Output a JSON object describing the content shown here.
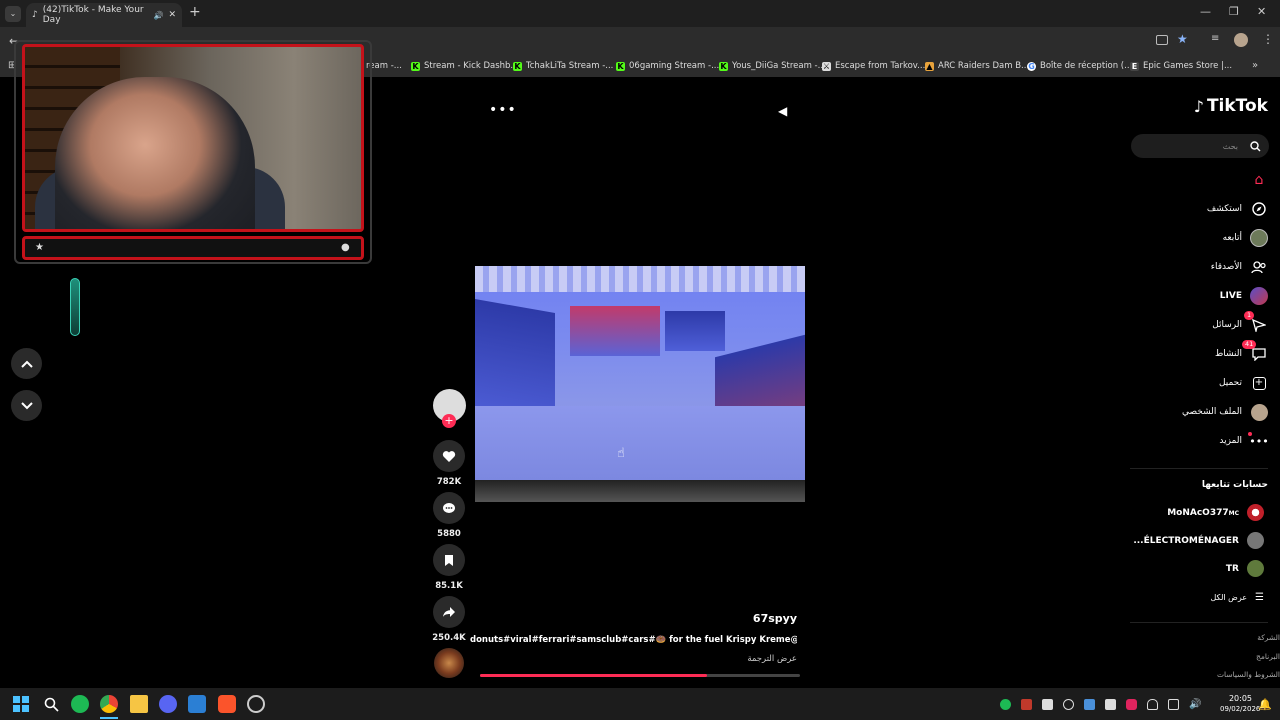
{
  "browser": {
    "tab_title": "(42)TikTok - Make Your Day",
    "bookmarks": [
      "ream -...",
      "Stream - Kick Dashb...",
      "TchakLiTa Stream -...",
      "06gaming Stream -...",
      "Yous_DiiGa Stream -...",
      "Escape from Tarkov...",
      "ARC Raiders Dam B...",
      "Boîte de réception (...",
      "Epic Games Store |..."
    ]
  },
  "tiktok": {
    "logo": "TikTok",
    "search_placeholder": "بحث",
    "nav": [
      {
        "label": "",
        "icon": "home-icon",
        "active": true
      },
      {
        "label": "استكشف",
        "icon": "compass-icon"
      },
      {
        "label": "أتابعه",
        "icon": "avatar-icon"
      },
      {
        "label": "الأصدقاء",
        "icon": "friends-icon"
      },
      {
        "label": "LIVE",
        "icon": "live-icon"
      },
      {
        "label": "الرسائل",
        "icon": "messages-icon",
        "badge": "1"
      },
      {
        "label": "النشاط",
        "icon": "activity-icon",
        "badge": "41"
      },
      {
        "label": "تحميل",
        "icon": "upload-icon"
      },
      {
        "label": "الملف الشخصي",
        "icon": "profile-icon"
      },
      {
        "label": "المزيد",
        "icon": "more-icon"
      }
    ],
    "following_title": "حسابات تتابعها",
    "following": [
      {
        "name": "MoNAcO377",
        "tag": "MC"
      },
      {
        "name": "...ÉLECTROMÉNAGER",
        "tag": ""
      },
      {
        "name": "TR",
        "tag": ""
      }
    ],
    "see_all": "عرض الكل",
    "footer": [
      "الشركة",
      "البرنامج",
      "الشروط والسياسات"
    ]
  },
  "post": {
    "author": "67spyy",
    "caption": "donuts#viral#ferrari#samsclub#cars#🍩 for the fuel Krispy Kreme@",
    "translate": "عرض الترجمة",
    "progress": 0.71,
    "likes": "782K",
    "comments": "5880",
    "saves": "85.1K",
    "shares": "250.4K"
  },
  "taskbar": {
    "time": "20:05",
    "date": "09/02/2026"
  },
  "colors": {
    "accent": "#fe2c55",
    "cam_frame": "#c4121a"
  }
}
